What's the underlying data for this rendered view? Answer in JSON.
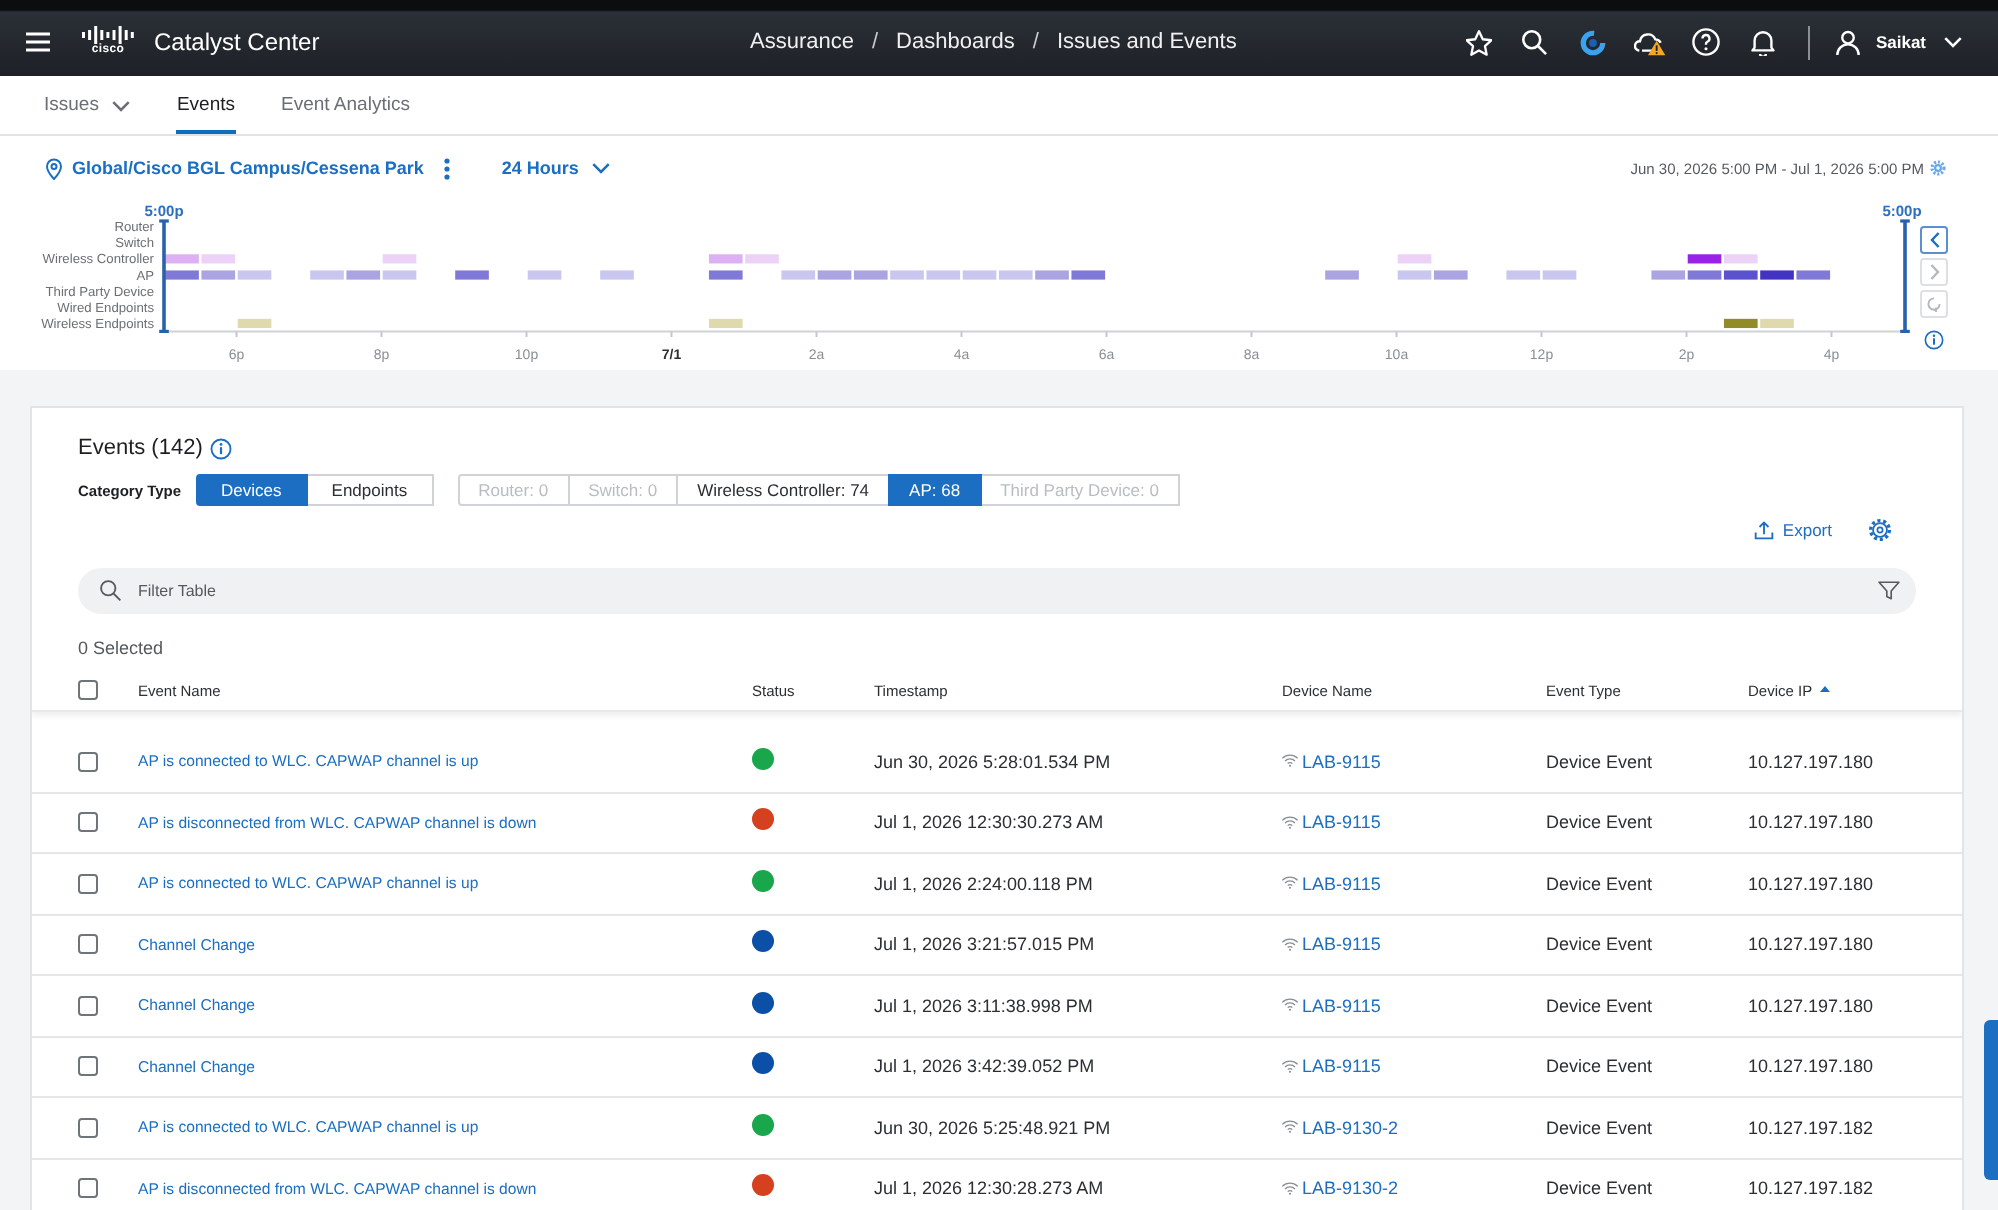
{
  "header": {
    "logo_text": "cisco",
    "app_title": "Catalyst Center",
    "breadcrumbs": [
      {
        "label": "Assurance",
        "kind": "crumb"
      },
      {
        "label": "/",
        "kind": "separator"
      },
      {
        "label": "Dashboards",
        "kind": "crumb"
      },
      {
        "label": "/",
        "kind": "separator"
      },
      {
        "label": "Issues and Events",
        "kind": "crumb"
      }
    ],
    "user": "Saikat"
  },
  "tabs": [
    {
      "label": "Issues",
      "selected": false,
      "dropdown": true
    },
    {
      "label": "Events",
      "selected": true,
      "dropdown": false
    },
    {
      "label": "Event Analytics",
      "selected": false,
      "dropdown": false
    }
  ],
  "scope": {
    "location": "Global/Cisco BGL Campus/Cessena Park",
    "time_range": "24 Hours",
    "date_range": "Jun 30, 2026 5:00 PM - Jul 1, 2026 5:00 PM"
  },
  "timeline": {
    "start_label": "5:00p",
    "end_label": "5:00p",
    "rows": [
      "Router",
      "Switch",
      "Wireless Controller",
      "AP",
      "Third Party Device",
      "Wired Endpoints",
      "Wireless Endpoints"
    ],
    "ticks": [
      {
        "label": "6p",
        "kind": "time"
      },
      {
        "label": "8p",
        "kind": "time"
      },
      {
        "label": "10p",
        "kind": "time"
      },
      {
        "label": "7/1",
        "kind": "date"
      },
      {
        "label": "2a",
        "kind": "time"
      },
      {
        "label": "4a",
        "kind": "time"
      },
      {
        "label": "6a",
        "kind": "time"
      },
      {
        "label": "8a",
        "kind": "time"
      },
      {
        "label": "10a",
        "kind": "time"
      },
      {
        "label": "12p",
        "kind": "time"
      },
      {
        "label": "2p",
        "kind": "time"
      },
      {
        "label": "4p",
        "kind": "time"
      }
    ],
    "controls": [
      {
        "kind": "previous",
        "disabled": false
      },
      {
        "kind": "next",
        "disabled": true
      },
      {
        "kind": "reset",
        "disabled": true
      }
    ]
  },
  "events": {
    "title": "Events (142)",
    "category_label": "Category Type",
    "categories": [
      {
        "label": "Devices",
        "selected": true
      },
      {
        "label": "Endpoints",
        "selected": false
      }
    ],
    "device_filters": [
      {
        "label": "Router: 0",
        "selected": false,
        "disabled": true
      },
      {
        "label": "Switch: 0",
        "selected": false,
        "disabled": true
      },
      {
        "label": "Wireless Controller: 74",
        "selected": false,
        "disabled": false
      },
      {
        "label": "AP: 68",
        "selected": true,
        "disabled": false
      },
      {
        "label": "Third Party Device: 0",
        "selected": false,
        "disabled": true
      }
    ],
    "export_label": "Export",
    "filter": {
      "placeholder": "Filter Table"
    },
    "selected_count": "0 Selected",
    "table": {
      "select_all_checked": false,
      "columns": [
        {
          "label": "Event Name",
          "sorted": false
        },
        {
          "label": "Status",
          "sorted": false
        },
        {
          "label": "Timestamp",
          "sorted": false
        },
        {
          "label": "Device Name",
          "sorted": false
        },
        {
          "label": "Event Type",
          "sorted": false
        },
        {
          "label": "Device IP",
          "sorted": true
        }
      ],
      "rows": [
        {
          "checked": false,
          "event_name": "AP is connected to WLC. CAPWAP channel is up",
          "color": "#1aa64b",
          "timestamp": "Jun 30, 2026 5:28:01.534 PM",
          "device_name": "LAB-9115",
          "event_type": "Device Event",
          "device_ip": "10.127.197.180"
        },
        {
          "checked": false,
          "event_name": "AP is disconnected from WLC. CAPWAP channel is down",
          "color": "#d5401f",
          "timestamp": "Jul 1, 2026 12:30:30.273 AM",
          "device_name": "LAB-9115",
          "event_type": "Device Event",
          "device_ip": "10.127.197.180"
        },
        {
          "checked": false,
          "event_name": "AP is connected to WLC. CAPWAP channel is up",
          "color": "#1aa64b",
          "timestamp": "Jul 1, 2026 2:24:00.118 PM",
          "device_name": "LAB-9115",
          "event_type": "Device Event",
          "device_ip": "10.127.197.180"
        },
        {
          "checked": false,
          "event_name": "Channel Change",
          "color": "#0b4fa6",
          "timestamp": "Jul 1, 2026 3:21:57.015 PM",
          "device_name": "LAB-9115",
          "event_type": "Device Event",
          "device_ip": "10.127.197.180"
        },
        {
          "checked": false,
          "event_name": "Channel Change",
          "color": "#0b4fa6",
          "timestamp": "Jul 1, 2026 3:11:38.998 PM",
          "device_name": "LAB-9115",
          "event_type": "Device Event",
          "device_ip": "10.127.197.180"
        },
        {
          "checked": false,
          "event_name": "Channel Change",
          "color": "#0b4fa6",
          "timestamp": "Jul 1, 2026 3:42:39.052 PM",
          "device_name": "LAB-9115",
          "event_type": "Device Event",
          "device_ip": "10.127.197.180"
        },
        {
          "checked": false,
          "event_name": "AP is connected to WLC. CAPWAP channel is up",
          "color": "#1aa64b",
          "timestamp": "Jun 30, 2026 5:25:48.921 PM",
          "device_name": "LAB-9130-2",
          "event_type": "Device Event",
          "device_ip": "10.127.197.182"
        },
        {
          "checked": false,
          "event_name": "AP is disconnected from WLC. CAPWAP channel is down",
          "color": "#d5401f",
          "timestamp": "Jul 1, 2026 12:30:28.273 AM",
          "device_name": "LAB-9130-2",
          "event_type": "Device Event",
          "device_ip": "10.127.197.182"
        }
      ]
    }
  }
}
